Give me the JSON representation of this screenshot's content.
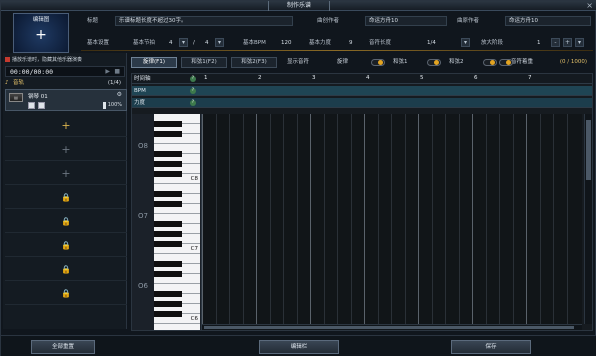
{
  "window": {
    "title": "制作乐谱",
    "close_icon": "×"
  },
  "cover": {
    "label": "编辑图",
    "plus": "+"
  },
  "header": {
    "row1": {
      "title_label": "标题",
      "title_value": "乐谱标题长度不超过30字。",
      "composer_label": "曲创作者",
      "composer_value": "命运方舟10",
      "lyricist_label": "曲原作者",
      "lyricist_value": "命运方舟10"
    },
    "row2": {
      "settings_label": "基本设置",
      "time_sig_label": "基本节拍",
      "time_sig_num": "4",
      "time_sig_sep": "/",
      "time_sig_den": "4",
      "bpm_label": "基本BPM",
      "bpm_value": "120",
      "velocity_label": "基本力度",
      "velocity_value": "9",
      "note_len_label": "音符长度",
      "note_len_value": "1/4",
      "zoom_label": "放大阶段",
      "zoom_value": "1",
      "minus": "-",
      "plus": "+"
    }
  },
  "left_panel": {
    "checkbox_label": "播放乐谱时，隐藏其他乐器演奏",
    "time": "00:00/00:00",
    "track_header": "音轨",
    "track_count": "(1/4)",
    "track": {
      "instrument": "钢琴 01",
      "volume": "100%"
    },
    "slots": [
      "+",
      "+",
      "+",
      "🔒",
      "🔒",
      "🔒",
      "🔒",
      "🔒"
    ]
  },
  "tabs": {
    "items": [
      "旋律(F1)",
      "和弦1(F2)",
      "和弦2(F3)"
    ],
    "show_notes_label": "显示音符",
    "toggle_labels": [
      "旋律",
      "和弦1",
      "和弦2",
      "音符着重"
    ],
    "pages": "(0 / 1000)"
  },
  "grid": {
    "rows": [
      "时间轴",
      "BPM",
      "力度"
    ],
    "help": "?",
    "bar_numbers": [
      "1",
      "2",
      "3",
      "4",
      "5",
      "6",
      "7"
    ],
    "octaves": [
      "O8",
      "O7",
      "O6"
    ],
    "key_labels": [
      "C8",
      "C7",
      "C6"
    ]
  },
  "bottom": {
    "reset": "全部重置",
    "edit": "编辑栏",
    "save": "保存"
  }
}
